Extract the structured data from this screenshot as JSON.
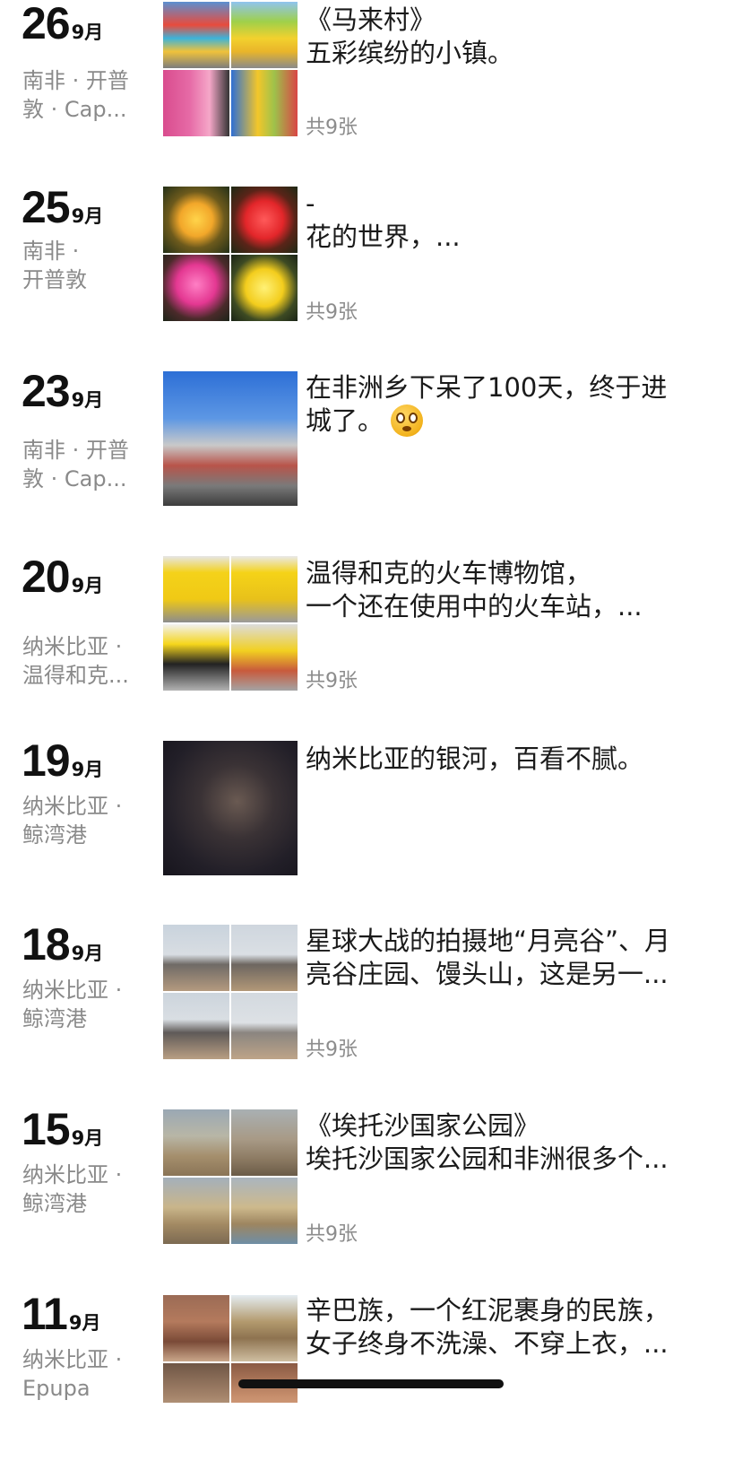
{
  "posts": [
    {
      "day": "26",
      "month": "9月",
      "location": "南非 · 开普敦 · Cap...",
      "lines": [
        "《马来村》",
        "五彩缤纷的小镇。"
      ],
      "count": "共9张",
      "photo": "马来村"
    },
    {
      "day": "25",
      "month": "9月",
      "location": "南非 · 开普敦",
      "lines": [
        "-",
        "花的世界，..."
      ],
      "count": "共9张",
      "photo": "flowers"
    },
    {
      "day": "23",
      "month": "9月",
      "location": "南非 · 开普敦 · Cap...",
      "lines": [
        "在非洲乡下呆了100天，终于进",
        "城了。"
      ],
      "emoji": "flushed-face-emoji",
      "count": "",
      "photo": "city"
    },
    {
      "day": "20",
      "month": "9月",
      "location": "纳米比亚 · 温得和克...",
      "lines": [
        "温得和克的火车博物馆，",
        "一个还在使用中的火车站，..."
      ],
      "count": "共9张",
      "photo": "train"
    },
    {
      "day": "19",
      "month": "9月",
      "location": "纳米比亚 · 鲸湾港",
      "lines": [
        "纳米比亚的银河，百看不腻。"
      ],
      "count": "",
      "photo": "milkyway"
    },
    {
      "day": "18",
      "month": "9月",
      "location": "纳米比亚 · 鲸湾港",
      "lines": [
        "星球大战的拍摄地“月亮谷”、月",
        "亮谷庄园、馒头山，这是另一..."
      ],
      "count": "共9张",
      "photo": "desert"
    },
    {
      "day": "15",
      "month": "9月",
      "location": "纳米比亚 · 鲸湾港",
      "lines": [
        "《埃托沙国家公园》",
        "埃托沙国家公园和非洲很多个..."
      ],
      "count": "共9张",
      "photo": "park"
    },
    {
      "day": "11",
      "month": "9月",
      "location": "纳米比亚 · Epupa",
      "lines": [
        "辛巴族，一个红泥裹身的民族，",
        "女子终身不洗澡、不穿上衣，..."
      ],
      "count": "",
      "photo": "tribe"
    }
  ],
  "colors": {
    "meta_gray": "#8a8a8a",
    "text": "#1a1a1a",
    "background": "#ffffff"
  }
}
